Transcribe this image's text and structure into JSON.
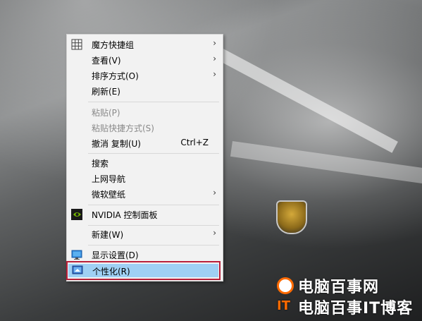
{
  "menu": {
    "items": [
      {
        "label": "魔方快捷组",
        "submenu": true,
        "icon": "grid-icon"
      },
      {
        "label": "查看(V)",
        "submenu": true
      },
      {
        "label": "排序方式(O)",
        "submenu": true
      },
      {
        "label": "刷新(E)"
      },
      {
        "label": "粘贴(P)",
        "disabled": true
      },
      {
        "label": "粘贴快捷方式(S)",
        "disabled": true
      },
      {
        "label": "撤消 复制(U)",
        "shortcut": "Ctrl+Z"
      },
      {
        "label": "搜索"
      },
      {
        "label": "上网导航"
      },
      {
        "label": "微软壁纸",
        "submenu": true
      },
      {
        "label": "NVIDIA 控制面板",
        "icon": "nvidia-icon"
      },
      {
        "label": "新建(W)",
        "submenu": true
      },
      {
        "label": "显示设置(D)",
        "icon": "display-icon"
      },
      {
        "label": "个性化(R)",
        "icon": "personalize-icon",
        "highlighted": true
      }
    ],
    "submenu_arrow": "›"
  },
  "watermark": {
    "line1": "电脑百事网",
    "line2": "电脑百事IT博客",
    "it_badge": "IT",
    "accent_color": "#ff6a00"
  },
  "colors": {
    "menu_bg": "#f2f2f2",
    "highlight_fill": "#9fd0f4",
    "highlight_border": "#b8203a",
    "nvidia_green": "#76b900"
  }
}
